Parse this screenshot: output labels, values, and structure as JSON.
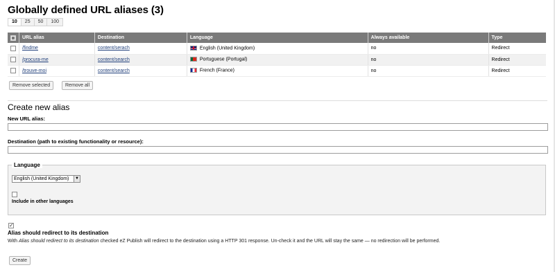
{
  "page": {
    "title": "Globally defined URL aliases (3)",
    "pager": [
      "10",
      "25",
      "50",
      "100"
    ]
  },
  "table": {
    "columns": [
      "URL alias",
      "Destination",
      "Language",
      "Always available",
      "Type"
    ],
    "rows": [
      {
        "alias": "/findme",
        "destination": "content/serach",
        "language": "English (United Kingdom)",
        "flag": "gb-flag-icon",
        "always_available": "no",
        "type": "Redirect"
      },
      {
        "alias": "/procura-me",
        "destination": "content/search",
        "language": "Portuguese (Portugal)",
        "flag": "pt-flag-icon",
        "always_available": "no",
        "type": "Redirect"
      },
      {
        "alias": "/trouve-moi",
        "destination": "content/search",
        "language": "French (France)",
        "flag": "fr-flag-icon",
        "always_available": "no",
        "type": "Redirect"
      }
    ]
  },
  "actions": {
    "remove_selected": "Remove selected",
    "remove_all": "Remove all"
  },
  "create": {
    "title": "Create new alias",
    "new_alias_label": "New URL alias:",
    "new_alias_value": "",
    "destination_label": "Destination (path to existing functionality or resource):",
    "destination_value": "",
    "language_legend": "Language",
    "language_selected": "English (United Kingdom)",
    "include_other_languages": "Include in other languages",
    "include_other_checked": false,
    "redirect_label": "Alias should redirect to its destination",
    "redirect_checked": true,
    "help_prefix": "With ",
    "help_em": "Alias should redirect to its destination",
    "help_suffix": " checked eZ Publish will redirect to the destination using a HTTP 301 response. Un-check it and the URL will stay the same — no redirection will be performed.",
    "create_button": "Create"
  }
}
